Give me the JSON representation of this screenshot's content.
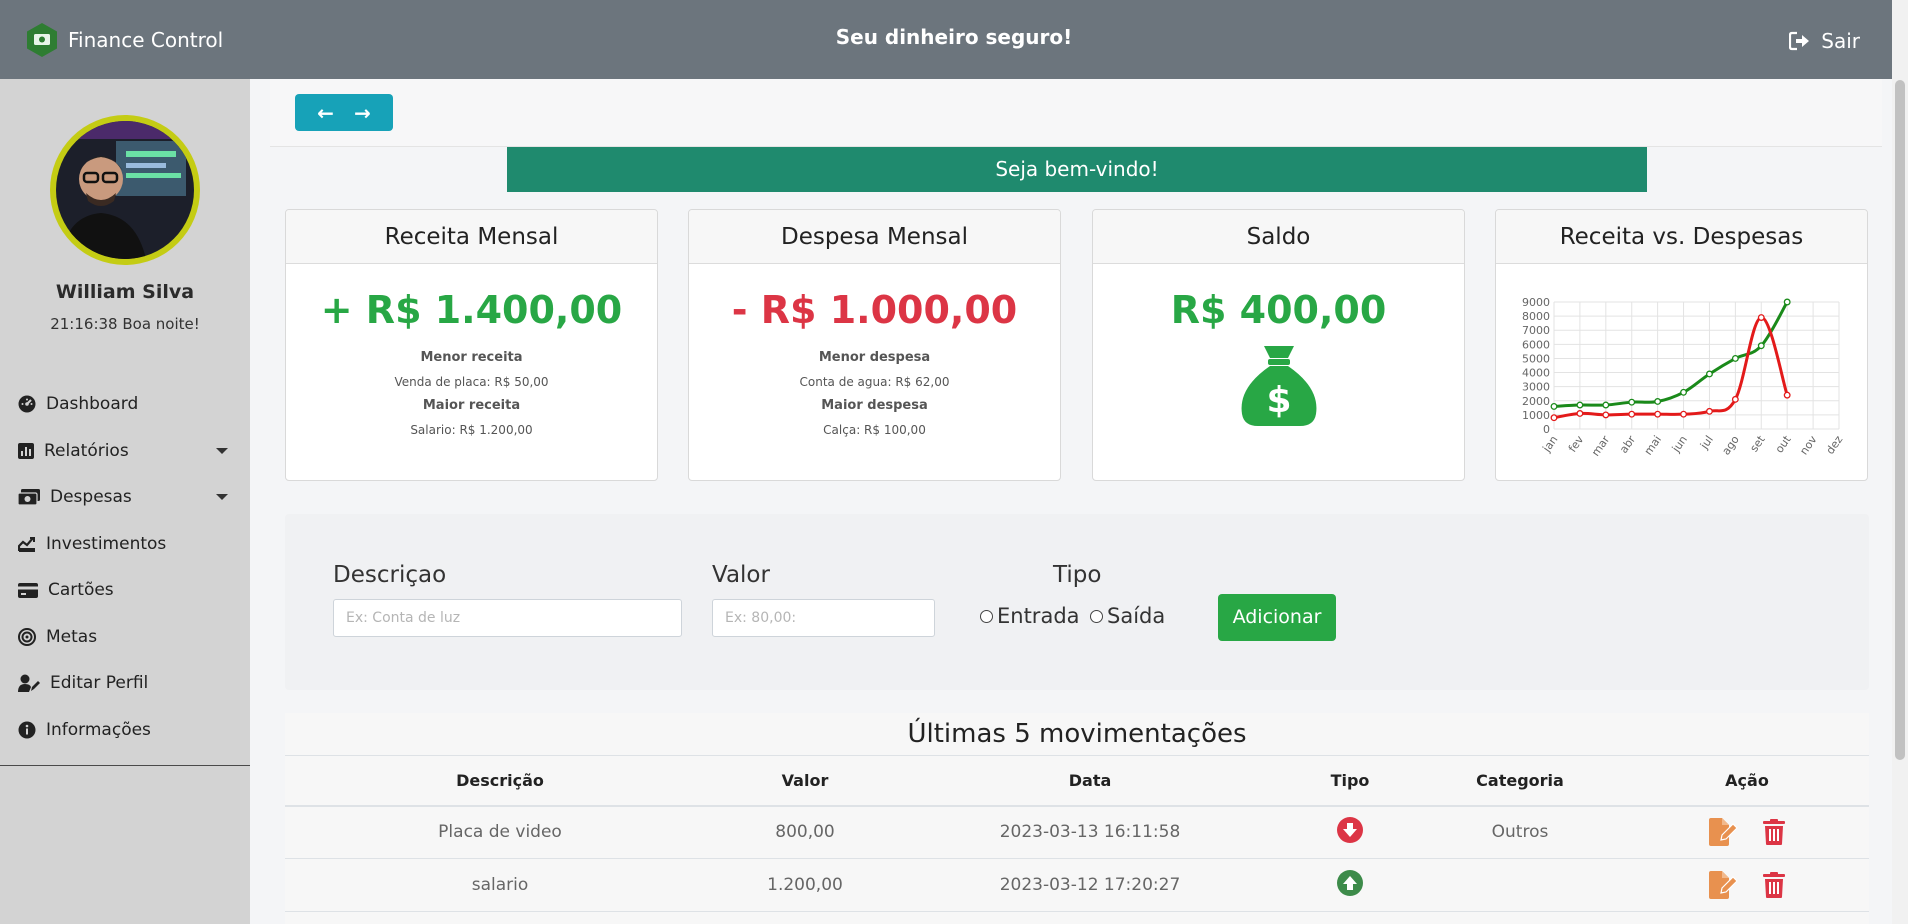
{
  "topbar": {
    "brand": "Finance Control",
    "slogan": "Seu dinheiro seguro!",
    "logout_label": "Sair"
  },
  "sidebar": {
    "user_name": "William Silva",
    "greeting": "21:16:38 Boa noite!",
    "items": [
      {
        "label": "Dashboard",
        "icon": "dashboard-gauge-icon"
      },
      {
        "label": "Relatórios",
        "icon": "bar-chart-icon",
        "has_caret": true
      },
      {
        "label": "Despesas",
        "icon": "money-bills-icon",
        "has_caret": true
      },
      {
        "label": "Investimentos",
        "icon": "chart-line-icon"
      },
      {
        "label": "Cartões",
        "icon": "credit-card-icon"
      },
      {
        "label": "Metas",
        "icon": "target-icon"
      },
      {
        "label": "Editar Perfil",
        "icon": "user-edit-icon"
      },
      {
        "label": "Informações",
        "icon": "info-circle-icon"
      }
    ]
  },
  "welcome": "Seja bem-vindo!",
  "cards": {
    "receita": {
      "title": "Receita Mensal",
      "amount": "+ R$ 1.400,00",
      "min_label": "Menor receita",
      "min_value": "Venda de placa: R$ 50,00",
      "max_label": "Maior receita",
      "max_value": "Salario: R$ 1.200,00"
    },
    "despesa": {
      "title": "Despesa Mensal",
      "amount": "- R$ 1.000,00",
      "min_label": "Menor despesa",
      "min_value": "Conta de agua: R$ 62,00",
      "max_label": "Maior despesa",
      "max_value": "Calça: R$ 100,00"
    },
    "saldo": {
      "title": "Saldo",
      "amount": "R$ 400,00"
    },
    "chart": {
      "title": "Receita vs. Despesas"
    }
  },
  "chart_data": {
    "type": "line",
    "title": "Receita vs. Despesas",
    "categories": [
      "jan",
      "fev",
      "mar",
      "abr",
      "mai",
      "jun",
      "jul",
      "ago",
      "set",
      "out",
      "nov",
      "dez"
    ],
    "y_ticks": [
      0,
      1000,
      2000,
      3000,
      4000,
      5000,
      6000,
      7000,
      8000,
      9000
    ],
    "ylim": [
      0,
      9000
    ],
    "series": [
      {
        "color": "#1a8a1a",
        "values": [
          1600,
          1700,
          1700,
          1900,
          1950,
          2600,
          3900,
          5000,
          5900,
          9000,
          null,
          null
        ]
      },
      {
        "color": "#e31a1a",
        "values": [
          800,
          1100,
          1000,
          1050,
          1050,
          1050,
          1250,
          2100,
          7900,
          2400,
          null,
          null
        ]
      }
    ],
    "grid": true
  },
  "form": {
    "descricao_label": "Descriçao",
    "descricao_placeholder": "Ex: Conta de luz",
    "valor_label": "Valor",
    "valor_placeholder": "Ex: 80,00:",
    "tipo_label": "Tipo",
    "entrada_label": "Entrada",
    "saida_label": "Saída",
    "add_label": "Adicionar"
  },
  "table": {
    "title": "Últimas 5 movimentações",
    "headers": [
      "Descrição",
      "Valor",
      "Data",
      "Tipo",
      "Categoria",
      "Ação"
    ],
    "rows": [
      {
        "descricao": "Placa de video",
        "valor": "800,00",
        "data": "2023-03-13 16:11:58",
        "tipo": "saida",
        "categoria": "Outros"
      },
      {
        "descricao": "salario",
        "valor": "1.200,00",
        "data": "2023-03-12 17:20:27",
        "tipo": "entrada",
        "categoria": ""
      }
    ]
  },
  "colors": {
    "topbar": "#6c757d",
    "sidebar": "#d3d3d3",
    "welcome": "#1f8a6e",
    "green": "#28a745",
    "red": "#dc3545",
    "info": "#17a2b8",
    "edit": "#e8914f"
  }
}
